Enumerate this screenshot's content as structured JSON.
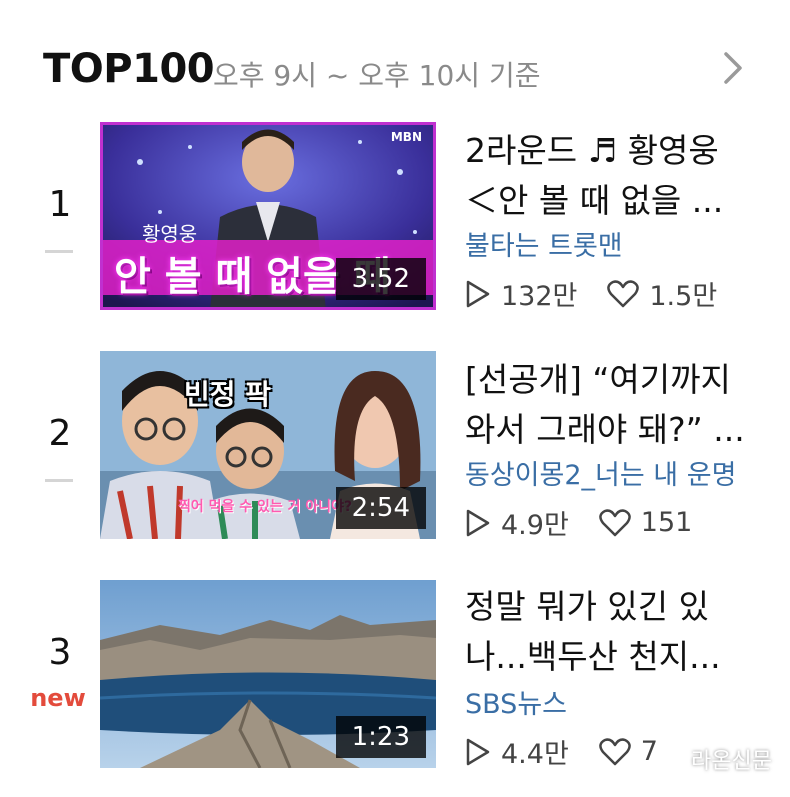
{
  "header": {
    "title": "TOP100",
    "subtitle": "오후 9시 ~ 오후 10시 기준"
  },
  "items": [
    {
      "rank": "1",
      "thumb_text": "안 볼 때 없을 때",
      "thumb_name": "황영웅",
      "thumb_logo": "MBN",
      "duration": "3:52",
      "title_line1": "2라운드 ♬ 황영웅",
      "title_line2": "＜안 볼 때 없을 ...",
      "channel": "불타는 트롯맨",
      "views": "132만",
      "likes": "1.5만"
    },
    {
      "rank": "2",
      "thumb_text": "빈정 팍",
      "thumb_sub": "찍어 먹을 수 있는 거 아니야?",
      "duration": "2:54",
      "title_line1": "[선공개] “여기까지",
      "title_line2": "와서 그래야 돼?” ...",
      "channel": "동상이몽2_너는 내 운명",
      "views": "4.9만",
      "likes": "151"
    },
    {
      "rank": "3",
      "badge": "new",
      "duration": "1:23",
      "title_line1": "정말 뭐가 있긴 있",
      "title_line2": "나...백두산 천지...",
      "channel": "SBS뉴스",
      "views": "4.4만",
      "likes": "7"
    }
  ],
  "watermark": "라온신문"
}
